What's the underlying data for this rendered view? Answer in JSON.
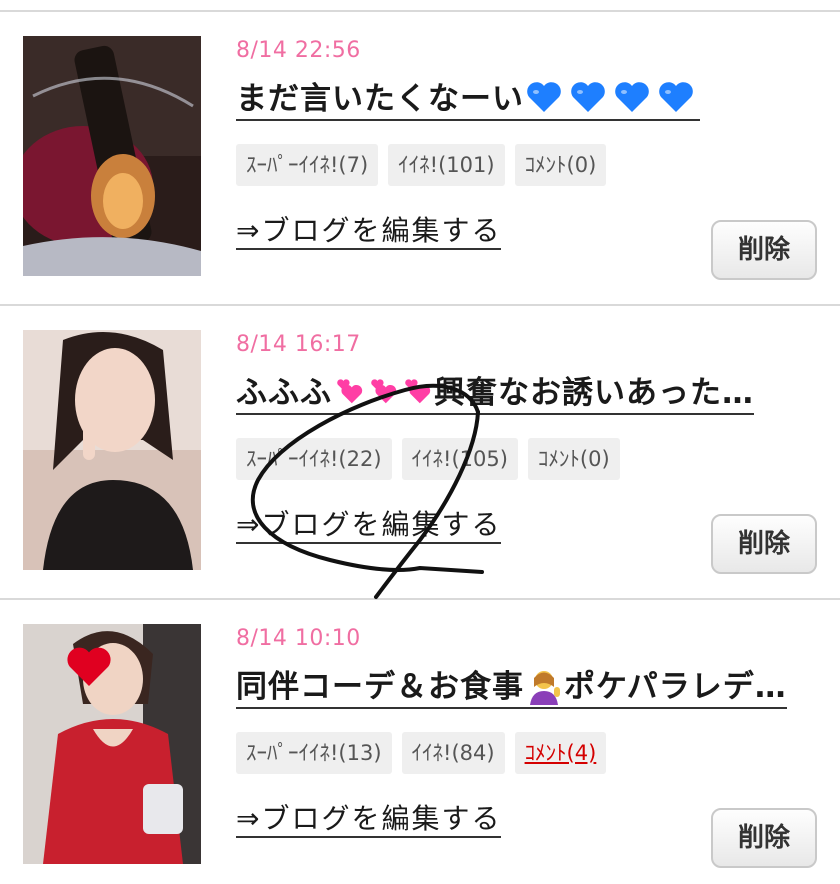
{
  "posts": [
    {
      "date": "8/14 22:56",
      "title": "まだ言いたくなーい",
      "title_icons": [
        "blue-heart",
        "blue-heart",
        "blue-heart",
        "blue-heart"
      ],
      "stats": {
        "super_like": "ｽｰﾊﾟｰｲｲﾈ!(7)",
        "like": "ｲｲﾈ!(101)",
        "comment": "ｺﾒﾝﾄ(0)"
      },
      "comment_is_link": false,
      "edit_link": "⇒ブログを編集する",
      "delete_label": "削除"
    },
    {
      "date": "8/14 16:17",
      "title_prefix": "ふふふ",
      "title_suffix": "興奮なお誘いあった…",
      "title_icons": [
        "two-pink-hearts",
        "two-pink-hearts",
        "two-pink-hearts"
      ],
      "stats": {
        "super_like": "ｽｰﾊﾟｰｲｲﾈ!(22)",
        "like": "ｲｲﾈ!(105)",
        "comment": "ｺﾒﾝﾄ(0)"
      },
      "comment_is_link": false,
      "edit_link": "⇒ブログを編集する",
      "delete_label": "削除"
    },
    {
      "date": "8/14 10:10",
      "title_prefix": "同伴コーデ＆お食事",
      "title_suffix": "ポケパラレデ…",
      "title_icons": [
        "person-tipping-hand"
      ],
      "stats": {
        "super_like": "ｽｰﾊﾟｰｲｲﾈ!(13)",
        "like": "ｲｲﾈ!(84)",
        "comment": "ｺﾒﾝﾄ(4)"
      },
      "comment_is_link": true,
      "edit_link": "⇒ブログを編集する",
      "delete_label": "削除"
    }
  ],
  "colors": {
    "date": "#f06ea2",
    "comment_link": "#d40000",
    "heart_blue": "#1e7fff",
    "heart_pink": "#ff3ea5"
  }
}
